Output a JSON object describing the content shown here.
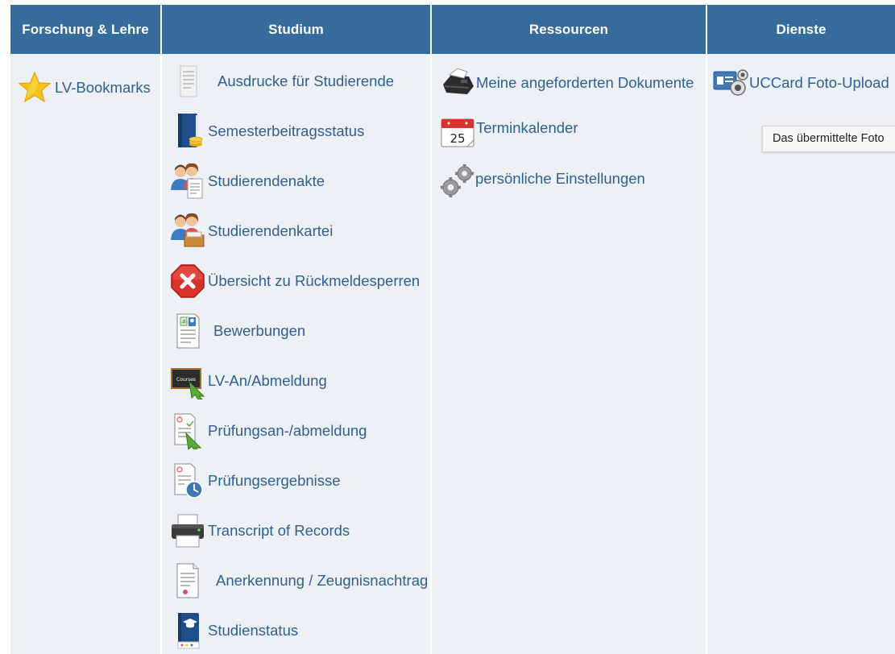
{
  "headers": [
    "Forschung & Lehre",
    "Studium",
    "Ressourcen",
    "Dienste"
  ],
  "forschung": [
    {
      "label": "LV-Bookmarks",
      "icon": "star-icon"
    }
  ],
  "studium": [
    {
      "label": "Ausdrucke für Studierende",
      "icon": "document-icon"
    },
    {
      "label": "Semesterbeitragsstatus",
      "icon": "book-coins-icon"
    },
    {
      "label": "Studierendenakte",
      "icon": "students-file-icon"
    },
    {
      "label": "Studierendenkartei",
      "icon": "students-cardbox-icon"
    },
    {
      "label": "Übersicht zu Rückmeldesperren",
      "icon": "stop-icon"
    },
    {
      "label": "Bewerbungen",
      "icon": "application-form-icon"
    },
    {
      "label": "LV-An/Abmeldung",
      "icon": "course-board-cursor-icon"
    },
    {
      "label": "Prüfungsan-/abmeldung",
      "icon": "exam-register-cursor-icon"
    },
    {
      "label": "Prüfungsergebnisse",
      "icon": "exam-results-clock-icon"
    },
    {
      "label": "Transcript of Records",
      "icon": "printer-icon"
    },
    {
      "label": "Anerkennung / Zeugnisnachtrag",
      "icon": "certificate-icon"
    },
    {
      "label": "Studienstatus",
      "icon": "graduation-book-icon"
    }
  ],
  "ressourcen": [
    {
      "label": "Meine angeforderten Dokumente",
      "icon": "fax-printer-icon"
    },
    {
      "label": "Terminkalender",
      "icon": "calendar-icon",
      "calendar_day": "25"
    },
    {
      "label": "persönliche Einstellungen",
      "icon": "gears-icon"
    }
  ],
  "dienste": [
    {
      "label": "UCCard Foto-Upload",
      "icon": "card-camera-icon"
    }
  ],
  "tooltip": "Das übermittelte Foto",
  "badge_text": "Courses"
}
